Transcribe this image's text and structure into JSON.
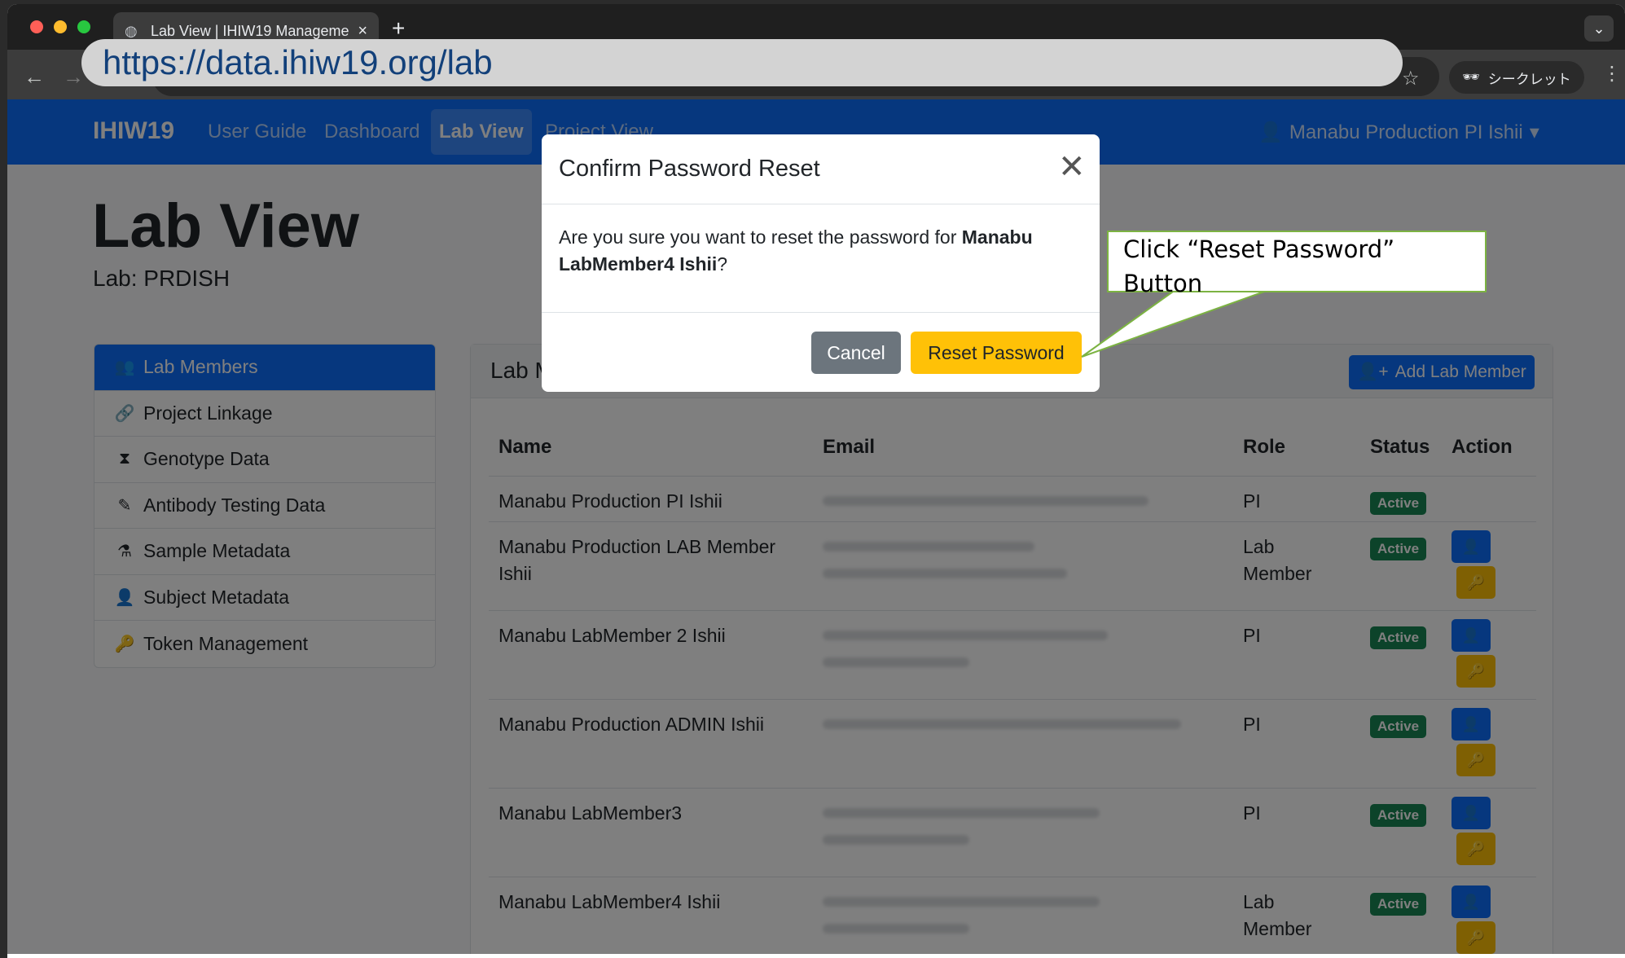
{
  "browser": {
    "tab_title": "Lab View | IHIW19 Manageme",
    "tab_close": "×",
    "new_tab": "+",
    "tab_menu": "⌄",
    "back": "←",
    "forward": "→",
    "star": "☆",
    "incognito_label": "シークレット",
    "menu": "⋮",
    "url": "https://data.ihiw19.org/lab"
  },
  "navbar": {
    "brand": "IHIW19",
    "links": [
      "User Guide",
      "Dashboard",
      "Lab View",
      "Project View"
    ],
    "user": "Manabu Production PI Ishii",
    "user_caret": "▾"
  },
  "page": {
    "title": "Lab View",
    "subtitle": "Lab: PRDISH"
  },
  "sidebar": {
    "items": [
      {
        "label": "Lab Members",
        "icon": "users-icon",
        "glyph": "👥"
      },
      {
        "label": "Project Linkage",
        "icon": "link-icon",
        "glyph": "🔗"
      },
      {
        "label": "Genotype Data",
        "icon": "hourglass-icon",
        "glyph": "⧗"
      },
      {
        "label": "Antibody Testing Data",
        "icon": "pen-icon",
        "glyph": "✎"
      },
      {
        "label": "Sample Metadata",
        "icon": "flask-icon",
        "glyph": "⚗"
      },
      {
        "label": "Subject Metadata",
        "icon": "person-icon",
        "glyph": "👤"
      },
      {
        "label": "Token Management",
        "icon": "key-icon",
        "glyph": "🔑"
      }
    ]
  },
  "card": {
    "title": "Lab M",
    "add_button": "Add Lab Member"
  },
  "table": {
    "headers": {
      "name": "Name",
      "email": "Email",
      "role": "Role",
      "status": "Status",
      "action": "Action"
    },
    "rows": [
      {
        "name": "Manabu Production PI Ishii",
        "role": "PI",
        "status": "Active"
      },
      {
        "name": "Manabu Production LAB Member Ishii",
        "role": "Lab Member",
        "status": "Active"
      },
      {
        "name": "Manabu LabMember 2 Ishii",
        "role": "PI",
        "status": "Active"
      },
      {
        "name": "Manabu Production ADMIN Ishii",
        "role": "PI",
        "status": "Active"
      },
      {
        "name": "Manabu LabMember3",
        "role": "PI",
        "status": "Active"
      },
      {
        "name": "Manabu LabMember4 Ishii",
        "role": "Lab Member",
        "status": "Active"
      }
    ]
  },
  "modal": {
    "title": "Confirm Password Reset",
    "close": "✕",
    "body_prefix": "Are you sure you want to reset the password for ",
    "body_name": "Manabu LabMember4 Ishii",
    "body_suffix": "?",
    "cancel": "Cancel",
    "reset": "Reset Password"
  },
  "callout": {
    "line1": "Click “Reset Password”",
    "line2": "Button"
  },
  "colors": {
    "primary": "#0d6efd",
    "warning": "#ffc107",
    "success": "#198754",
    "secondary": "#6c757d"
  }
}
